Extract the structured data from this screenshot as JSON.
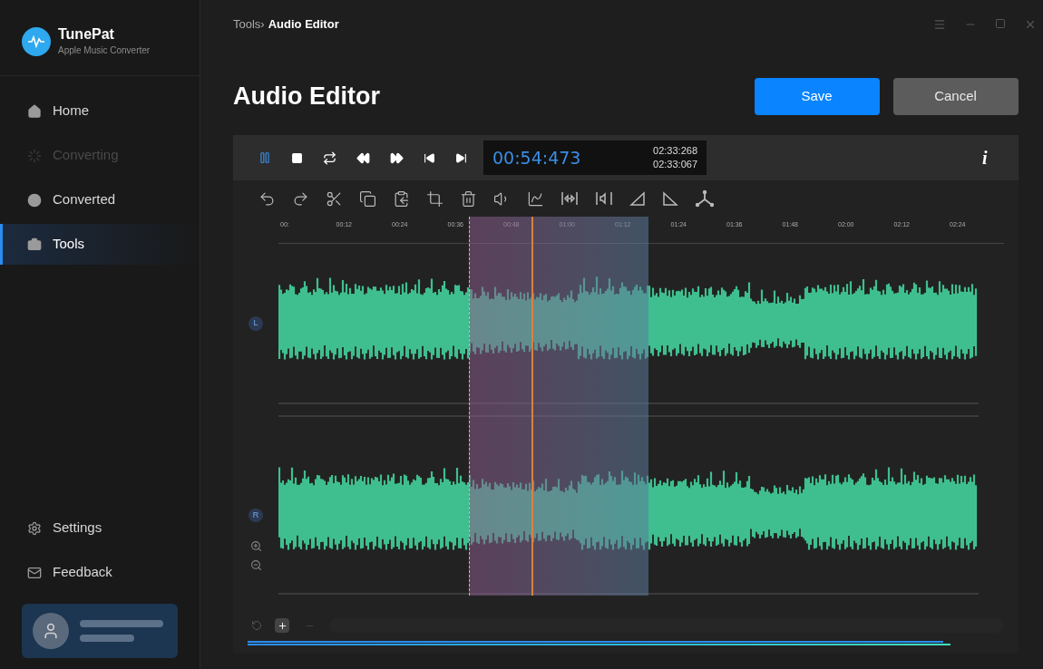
{
  "app": {
    "name": "TunePat",
    "subtitle": "Apple Music Converter"
  },
  "sidebar": {
    "items": [
      {
        "label": "Home",
        "selected": false,
        "disabled": false
      },
      {
        "label": "Converting",
        "selected": false,
        "disabled": true
      },
      {
        "label": "Converted",
        "selected": false,
        "disabled": false
      },
      {
        "label": "Tools",
        "selected": true,
        "disabled": false
      }
    ],
    "bottom_items": [
      {
        "label": "Settings"
      },
      {
        "label": "Feedback"
      }
    ]
  },
  "breadcrumb": {
    "parent": "Tools",
    "separator": "›",
    "current": "Audio Editor"
  },
  "title": "Audio Editor",
  "buttons": [
    {
      "label": "Save",
      "kind": "primary"
    },
    {
      "label": "Cancel",
      "kind": "secondary"
    }
  ],
  "transport": {
    "playing": true,
    "current_time": "00:54:473",
    "total_time": "02:33:268",
    "selection_time": "02:33:067",
    "info": "i"
  },
  "ruler": [
    "00:",
    "00:12",
    "00:24",
    "00:36",
    "00:48",
    "01:00",
    "01:12",
    "01:24",
    "01:36",
    "01:48",
    "02:00",
    "02:12",
    "02:24"
  ],
  "channels": [
    {
      "label": "L"
    },
    {
      "label": "R"
    }
  ]
}
